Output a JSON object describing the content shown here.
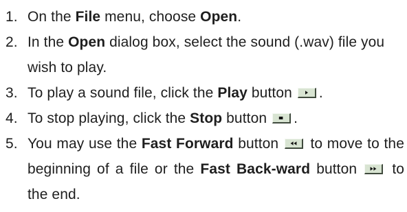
{
  "steps": [
    {
      "number": "1.",
      "t1": "On the ",
      "b1": "File",
      "t2": " menu, choose ",
      "b2": "Open",
      "t3": "."
    },
    {
      "number": "2.",
      "t1": "In the ",
      "b1": "Open",
      "t2": " dialog box, select the sound (.wav) file you wish to play."
    },
    {
      "number": "3.",
      "t1": "To play a sound file, click the ",
      "b1": "Play",
      "t2": " button",
      "icon": "play-icon",
      "t3": "."
    },
    {
      "number": "4.",
      "t1": "To stop playing, click the ",
      "b1": "Stop",
      "t2": " button",
      "icon": "stop-icon",
      "t3": "."
    },
    {
      "number": "5.",
      "t1": "You may use the ",
      "b1": "Fast Forward",
      "t2": " button",
      "icon1": "rewind-icon",
      "t3": "to move to the beginning of a file or the ",
      "b2": "Fast Back-ward",
      "t4": " button",
      "icon2": "fast-forward-icon",
      "t5": "to the end."
    }
  ],
  "colors": {
    "text": "#1e1e1e",
    "button_face": "#d8e4d2",
    "button_shadow": "#3f4a3d",
    "glyph": "#111111"
  }
}
